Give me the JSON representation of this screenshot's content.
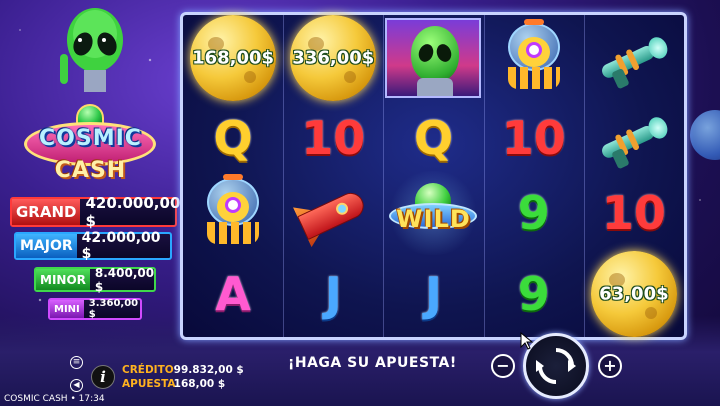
{
  "game": {
    "title": "COSMIC CASH",
    "clock": "17:34",
    "logo_line1": "COSMIC",
    "logo_line2": "CASH"
  },
  "jackpots": [
    {
      "name": "GRAND",
      "value": "420.000,00 $"
    },
    {
      "name": "MAJOR",
      "value": "42.000,00 $"
    },
    {
      "name": "MINOR",
      "value": "8.400,00 $"
    },
    {
      "name": "MINI",
      "value": "3.360,00 $"
    }
  ],
  "reels": {
    "moon_values": [
      "168,00$",
      "336,00$",
      "63,00$"
    ],
    "symbols": [
      [
        "moon",
        "moon",
        "alien",
        "octopus",
        "ray-gun"
      ],
      [
        "Q",
        "10",
        "Q",
        "10",
        "ray-gun"
      ],
      [
        "octopus",
        "rocket",
        "wild",
        "9",
        "10"
      ],
      [
        "A",
        "J",
        "J",
        "9",
        "moon"
      ]
    ],
    "letters": {
      "q": "Q",
      "ten": "10",
      "nine": "9",
      "a": "A",
      "j": "J",
      "wild": "WILD"
    }
  },
  "bottom": {
    "credit_label": "CRÉDITO",
    "credit_value": "99.832,00 $",
    "bet_label": "APUESTA",
    "bet_value": "168,00 $",
    "prompt": "¡HAGA SU APUESTA!",
    "minus": "−",
    "plus": "+",
    "info": "i"
  },
  "icons": [
    "menu-icon",
    "sound-icon",
    "info-icon",
    "spin-icon",
    "minus-icon",
    "plus-icon"
  ]
}
